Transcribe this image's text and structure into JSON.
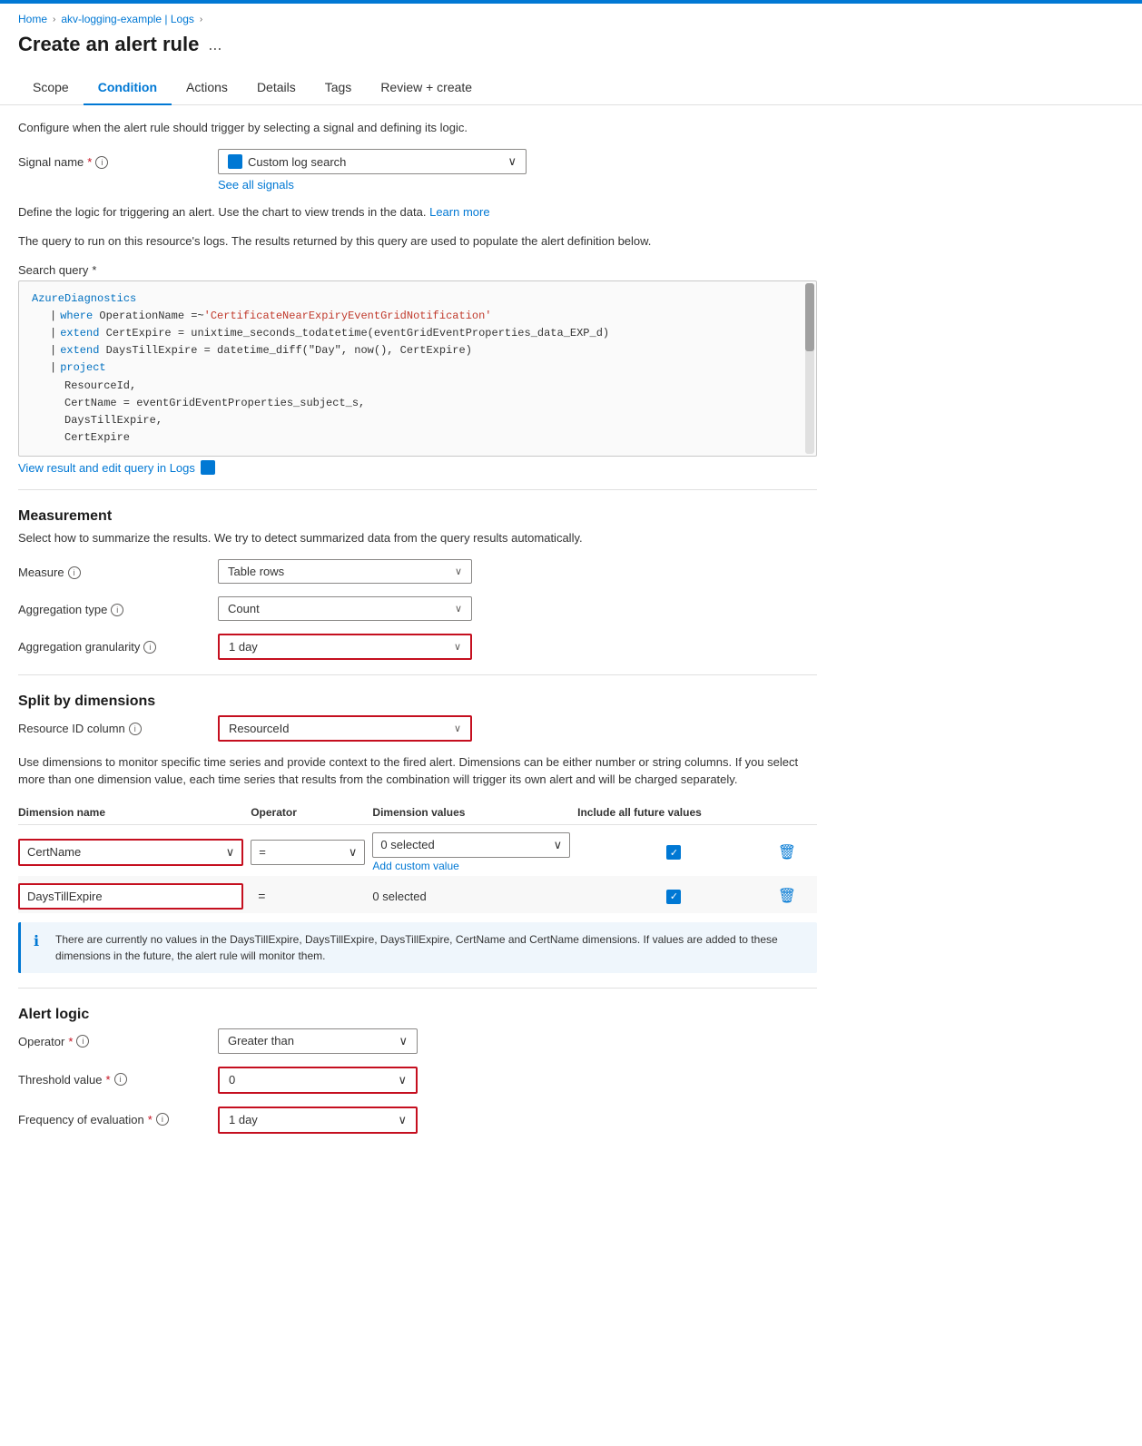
{
  "topbar": {
    "color": "#0078d4"
  },
  "breadcrumb": {
    "items": [
      "Home",
      "akv-logging-example | Logs"
    ]
  },
  "page": {
    "title": "Create an alert rule",
    "dots": "..."
  },
  "tabs": [
    {
      "label": "Scope",
      "active": false
    },
    {
      "label": "Condition",
      "active": true
    },
    {
      "label": "Actions",
      "active": false
    },
    {
      "label": "Details",
      "active": false
    },
    {
      "label": "Tags",
      "active": false
    },
    {
      "label": "Review + create",
      "active": false
    }
  ],
  "condition": {
    "scope_desc": "Configure when the alert rule should trigger by selecting a signal and defining its logic.",
    "signal_name_label": "Signal name",
    "signal_name_value": "Custom log search",
    "see_all_signals": "See all signals",
    "learn_more_desc1": "Define the logic for triggering an alert. Use the chart to view trends in the data.",
    "learn_more_link": "Learn more",
    "query_desc": "The query to run on this resource's logs. The results returned by this query are used to populate the alert definition below.",
    "search_query_label": "Search query",
    "query_lines": [
      {
        "indent": 0,
        "text": "AzureDiagnostics",
        "type": "plain"
      },
      {
        "indent": 1,
        "pipe": "| ",
        "keyword": "where",
        "rest": " OperationName =~ ",
        "string": "'CertificateNearExpiryEventGridNotification'"
      },
      {
        "indent": 1,
        "pipe": "| ",
        "keyword": "extend",
        "rest": " CertExpire = unixtime_seconds_todatetime(eventGridEventProperties_data_EXP_d)"
      },
      {
        "indent": 1,
        "pipe": "| ",
        "keyword": "extend",
        "rest": " DaysTillExpire = datetime_diff(\"Day\", now(), CertExpire)"
      },
      {
        "indent": 1,
        "pipe": "| ",
        "keyword": "project"
      },
      {
        "indent": 2,
        "rest": "ResourceId,"
      },
      {
        "indent": 2,
        "rest": "CertName = eventGridEventProperties_subject_s,"
      },
      {
        "indent": 2,
        "rest": "DaysTillExpire,"
      },
      {
        "indent": 2,
        "rest": "CertExpire"
      }
    ],
    "view_result_link": "View result and edit query in Logs",
    "measurement": {
      "title": "Measurement",
      "desc": "Select how to summarize the results. We try to detect summarized data from the query results automatically.",
      "measure_label": "Measure",
      "measure_value": "Table rows",
      "aggregation_type_label": "Aggregation type",
      "aggregation_type_value": "Count",
      "aggregation_granularity_label": "Aggregation granularity",
      "aggregation_granularity_value": "1 day",
      "aggregation_granularity_highlighted": true
    },
    "split_by_dimensions": {
      "title": "Split by dimensions",
      "resource_id_label": "Resource ID column",
      "resource_id_value": "ResourceId",
      "resource_id_highlighted": true,
      "dim_desc": "Use dimensions to monitor specific time series and provide context to the fired alert. Dimensions can be either number or string columns. If you select more than one dimension value, each time series that results from the combination will trigger its own alert and will be charged separately.",
      "columns": [
        "Dimension name",
        "Operator",
        "Dimension values",
        "Include all future values"
      ],
      "rows": [
        {
          "name": "CertName",
          "highlighted_name": true,
          "operator": "=",
          "values": "0 selected",
          "values_dropdown": true,
          "include_future": true,
          "add_custom": "Add custom value",
          "has_delete": true
        },
        {
          "name": "DaysTillExpire",
          "highlighted_name": true,
          "operator": "=",
          "values": "0 selected",
          "values_dropdown": false,
          "include_future": true,
          "has_delete": true
        }
      ],
      "info_text": "There are currently no values in the DaysTillExpire, DaysTillExpire, DaysTillExpire, CertName and CertName dimensions. If values are added to these dimensions in the future, the alert rule will monitor them."
    },
    "alert_logic": {
      "title": "Alert logic",
      "operator_label": "Operator",
      "operator_value": "Greater than",
      "threshold_label": "Threshold value",
      "threshold_value": "0",
      "threshold_highlighted": true,
      "frequency_label": "Frequency of evaluation",
      "frequency_value": "1 day",
      "frequency_highlighted": true
    }
  }
}
